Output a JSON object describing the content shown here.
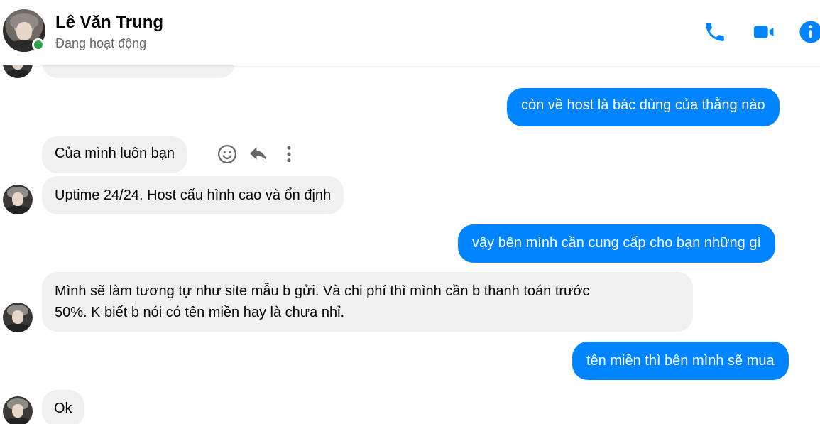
{
  "header": {
    "name": "Lê Văn Trung",
    "status": "Đang hoạt động",
    "icons": [
      "phone-icon",
      "video-call-icon",
      "info-icon"
    ]
  },
  "messages": [
    {
      "from": "them",
      "text": ""
    },
    {
      "from": "me",
      "text": "còn về host là bác dùng của thằng nào"
    },
    {
      "from": "them",
      "text": "Của mình luôn bạn"
    },
    {
      "from": "them",
      "text": "Uptime 24/24. Host cấu hình cao và ổn định"
    },
    {
      "from": "me",
      "text": "vậy bên mình cần cung cấp cho bạn những gì"
    },
    {
      "from": "them",
      "lines": [
        "Mình sẽ làm tương tự như site mẫu b gửi. Và chi phí thì mình cần b thanh toán trước",
        "50%. K biết b nói có tên miền hay là chưa nhỉ."
      ]
    },
    {
      "from": "me",
      "text": "tên miền thì bên mình sẽ mua"
    },
    {
      "from": "them",
      "text": "Ok"
    }
  ],
  "message_actions": [
    "emoji-react-icon",
    "reply-icon",
    "more-options-icon"
  ],
  "colors": {
    "accent": "#0084ff",
    "incoming_bubble": "#f0f0f0",
    "online": "#31a24c"
  }
}
